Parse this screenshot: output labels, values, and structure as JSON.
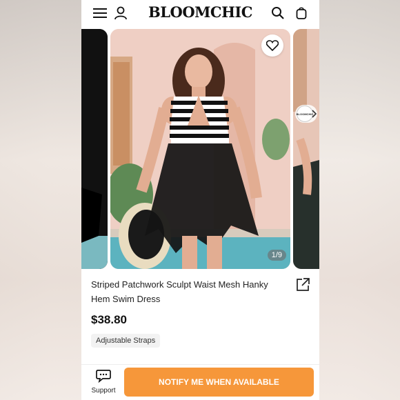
{
  "header": {
    "logo": "BLOOMCHIC",
    "icons": [
      "menu-icon",
      "user-icon",
      "search-icon",
      "shopping-bag-icon"
    ]
  },
  "gallery": {
    "counter": "1/9",
    "chip_text": "BLOOMCHIC"
  },
  "product": {
    "title": "Striped Patchwork Sculpt Waist Mesh Hanky Hem Swim Dress",
    "price": "$38.80",
    "tag": "Adjustable Straps"
  },
  "footer": {
    "support_label": "Support",
    "notify_label": "NOTIFY ME WHEN AVAILABLE"
  },
  "colors": {
    "accent": "#f6973a",
    "text": "#222222"
  }
}
